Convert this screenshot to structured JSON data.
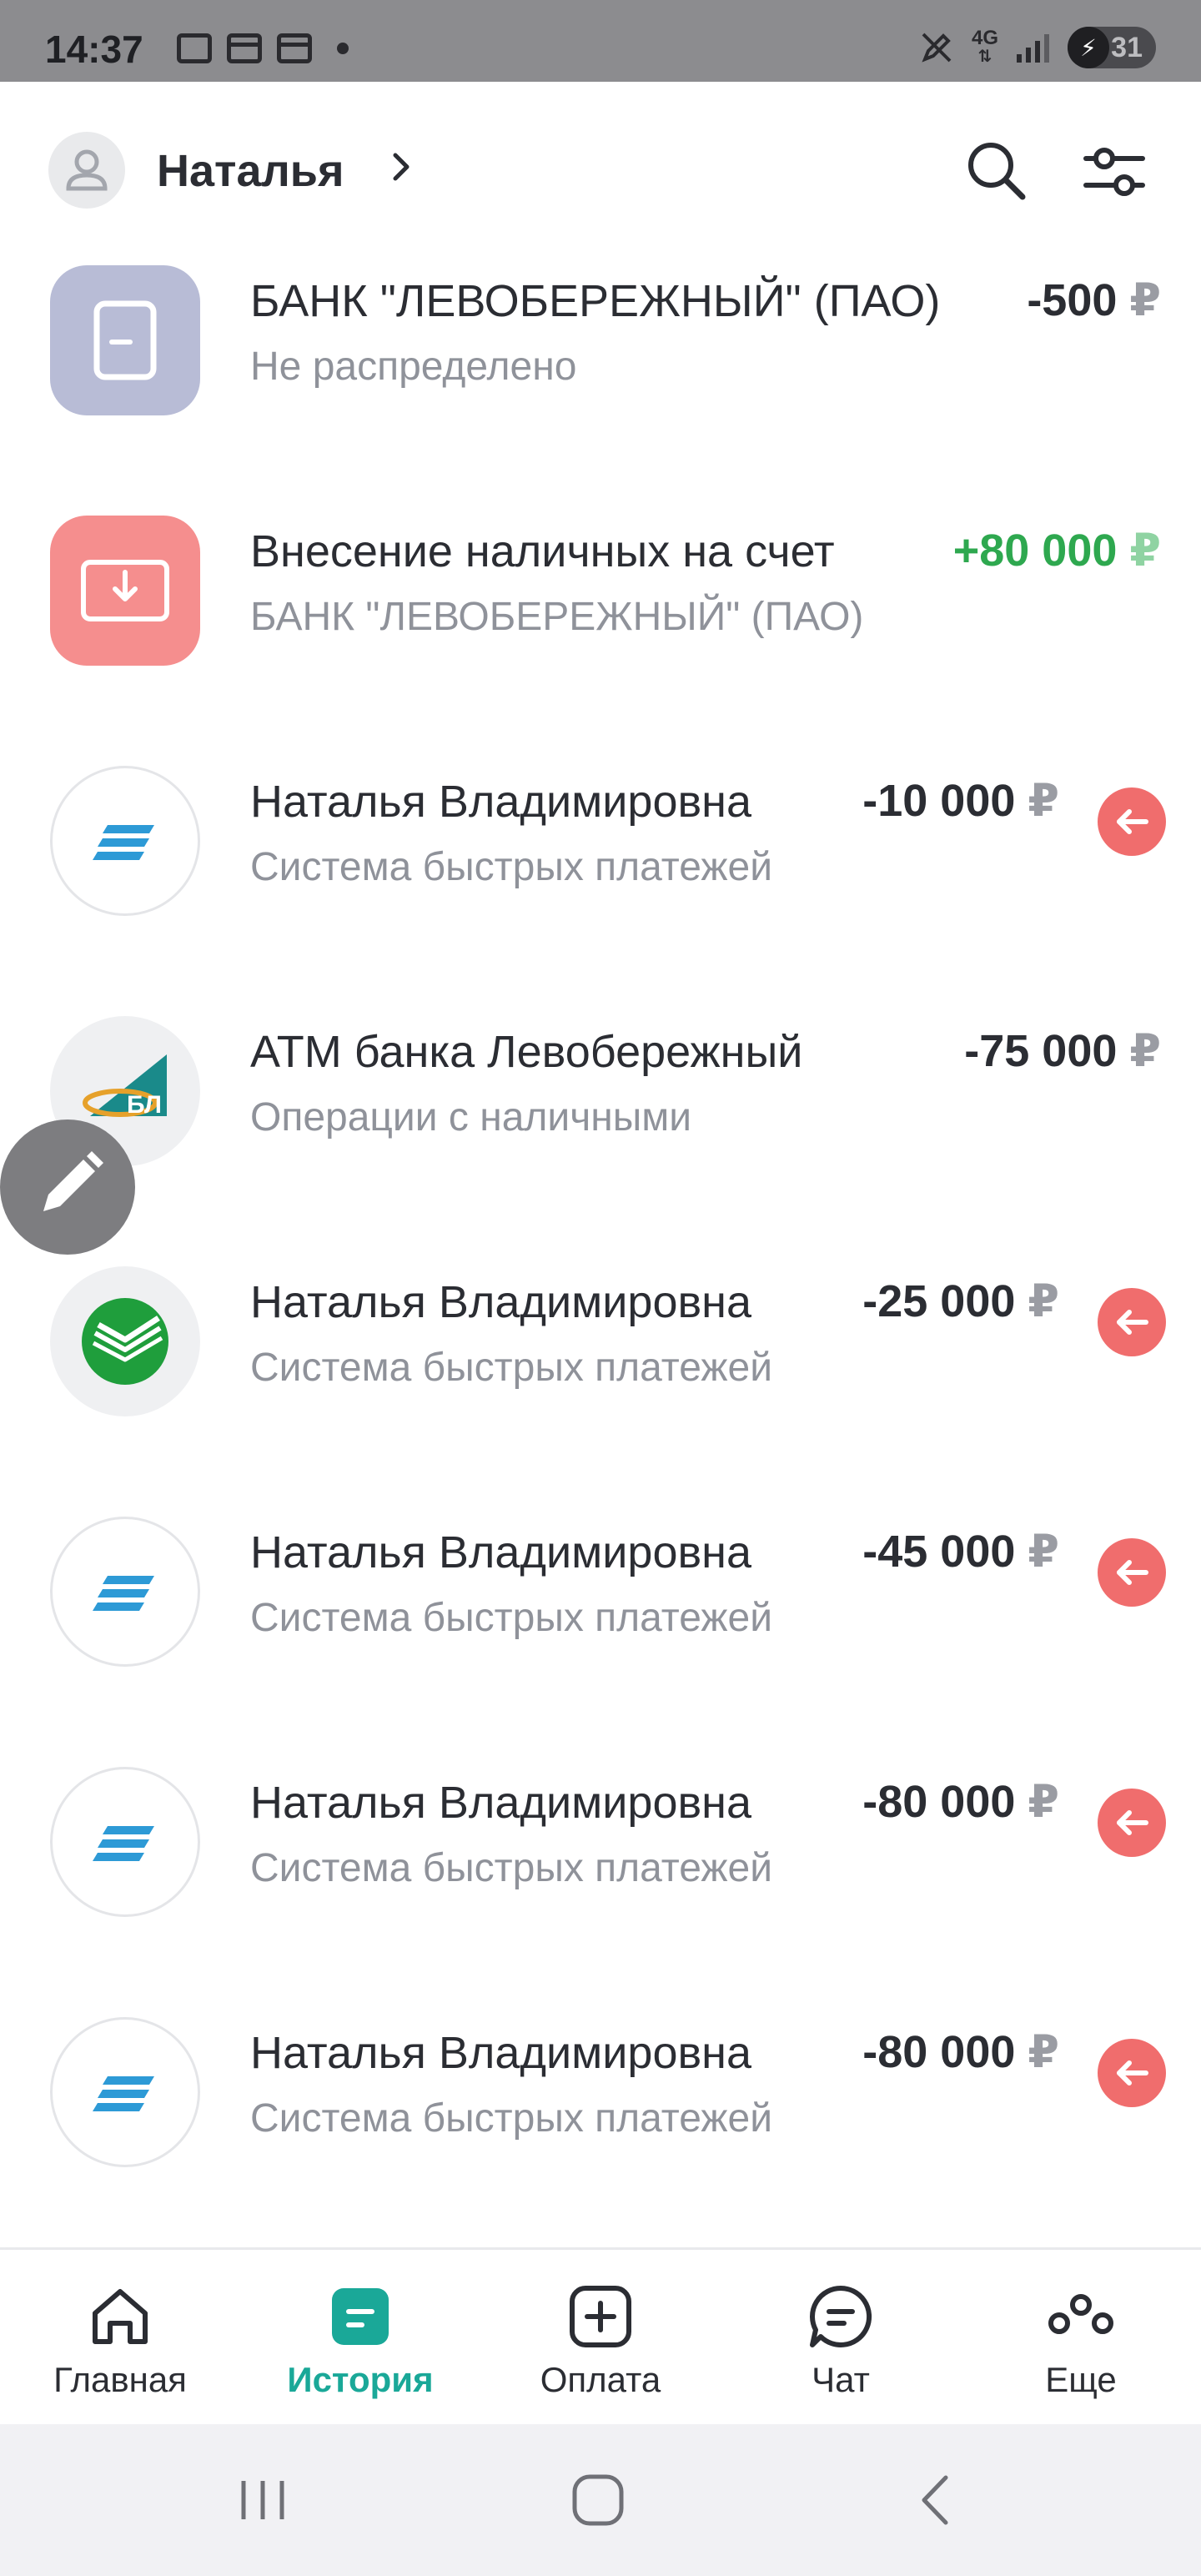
{
  "status_bar": {
    "time": "14:37",
    "network": "4G",
    "battery": "31"
  },
  "header": {
    "user_name": "Наталья"
  },
  "transactions": [
    {
      "title": "БАНК \"ЛЕВОБЕРЕЖНЫЙ\" (ПАО)",
      "subtitle": "Не распределено",
      "amount": "-500",
      "currency": "₽",
      "icon": "document-icon"
    },
    {
      "title": "Внесение наличных на счет",
      "subtitle": "БАНК \"ЛЕВОБЕРЕЖНЫЙ\" (ПАО)",
      "amount": "+80 000",
      "currency": "₽",
      "icon": "cash-deposit-icon"
    },
    {
      "title": "Наталья Владимировна",
      "subtitle": "Система быстрых платежей",
      "amount": "-10 000",
      "currency": "₽",
      "icon": "sbp-icon"
    },
    {
      "title": "АТМ банка Левобережный",
      "subtitle": "Операции с наличными",
      "amount": "-75 000",
      "currency": "₽",
      "icon": "bank-levoberezhny-logo"
    },
    {
      "title": "Наталья Владимировна",
      "subtitle": "Система быстрых платежей",
      "amount": "-25 000",
      "currency": "₽",
      "icon": "sberbank-logo"
    },
    {
      "title": "Наталья Владимировна",
      "subtitle": "Система быстрых платежей",
      "amount": "-45 000",
      "currency": "₽",
      "icon": "sbp-icon"
    },
    {
      "title": "Наталья Владимировна",
      "subtitle": "Система быстрых платежей",
      "amount": "-80 000",
      "currency": "₽",
      "icon": "sbp-icon"
    },
    {
      "title": "Наталья Владимировна",
      "subtitle": "Система быстрых платежей",
      "amount": "-80 000",
      "currency": "₽",
      "icon": "sbp-icon"
    }
  ],
  "bottom_nav": [
    {
      "label": "Главная",
      "icon": "home-icon"
    },
    {
      "label": "История",
      "icon": "history-icon",
      "active": true
    },
    {
      "label": "Оплата",
      "icon": "plus-square-icon"
    },
    {
      "label": "Чат",
      "icon": "chat-icon"
    },
    {
      "label": "Еще",
      "icon": "more-icon"
    }
  ],
  "colors": {
    "accent": "#1aa898",
    "income": "#2ea84f",
    "return_badge": "#f06d6d"
  }
}
